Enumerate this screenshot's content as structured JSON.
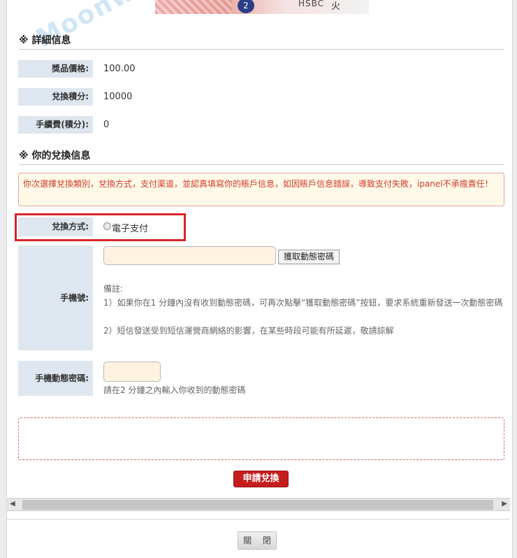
{
  "banner": {
    "bank_label": "HSBC",
    "coin_glyph": "2",
    "brand_mark": "火"
  },
  "details": {
    "section_title": "※ 詳細信息",
    "rows": [
      {
        "label": "獎品價格:",
        "value": "100.00"
      },
      {
        "label": "兌換積分:",
        "value": "10000"
      },
      {
        "label": "手續費(積分):",
        "value": "0"
      }
    ]
  },
  "exchange": {
    "section_title": "※ 你的兌換信息",
    "notice": "你次選擇兌換類別，兌換方式，支付渠道，並認真填寫你的賬戶信息，如因賬戶信息錯誤，導致支付失敗，ipanel不承擔責任！",
    "method_label": "兌換方式:",
    "method_option": "電子支付",
    "phone_label": "手機號:",
    "phone_value": "",
    "get_code_button": "獲取動態密碼",
    "notes_title": "備註:",
    "note_1": "1）如果你在1 分鐘內沒有收到動態密碼，可再次點擊“獲取動態密碼”按鈕，要求系統重新發送一次動態密碼",
    "note_2": "2）短信發送受到短信運營商網絡的影響，在某些時段可能有所延遲，敬請諒解",
    "code_label": "手機動態密碼:",
    "code_value": "",
    "code_hint": "請在2 分鐘之內輸入你收到的動態密碼",
    "submit_button": "申請兌換"
  },
  "footer": {
    "close_button": "關 閉"
  },
  "watermark": {
    "text": "Moonwood"
  },
  "colors": {
    "label_bg": "#dee6ef",
    "accent_red": "#c51d1d",
    "highlight_red": "#d9252b",
    "input_bg": "#fdf3e0",
    "notice_text": "#d03b2b"
  }
}
